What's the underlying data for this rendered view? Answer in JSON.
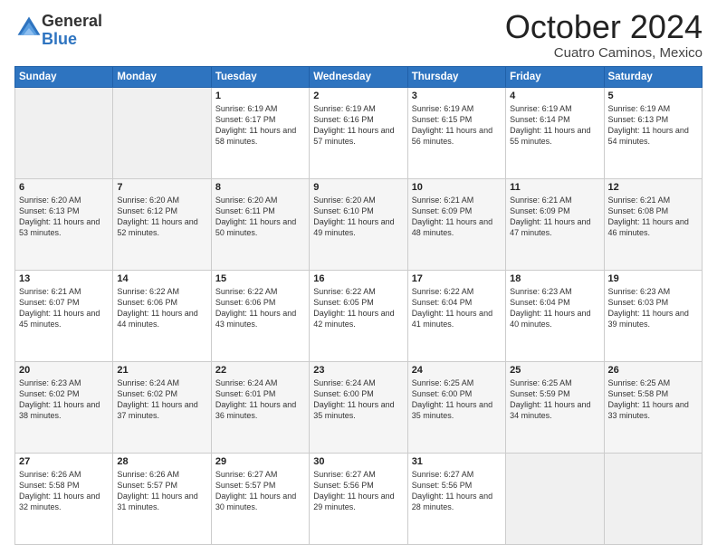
{
  "logo": {
    "general": "General",
    "blue": "Blue"
  },
  "title": {
    "month": "October 2024",
    "location": "Cuatro Caminos, Mexico"
  },
  "headers": [
    "Sunday",
    "Monday",
    "Tuesday",
    "Wednesday",
    "Thursday",
    "Friday",
    "Saturday"
  ],
  "weeks": [
    [
      {
        "day": "",
        "info": ""
      },
      {
        "day": "",
        "info": ""
      },
      {
        "day": "1",
        "info": "Sunrise: 6:19 AM\nSunset: 6:17 PM\nDaylight: 11 hours and 58 minutes."
      },
      {
        "day": "2",
        "info": "Sunrise: 6:19 AM\nSunset: 6:16 PM\nDaylight: 11 hours and 57 minutes."
      },
      {
        "day": "3",
        "info": "Sunrise: 6:19 AM\nSunset: 6:15 PM\nDaylight: 11 hours and 56 minutes."
      },
      {
        "day": "4",
        "info": "Sunrise: 6:19 AM\nSunset: 6:14 PM\nDaylight: 11 hours and 55 minutes."
      },
      {
        "day": "5",
        "info": "Sunrise: 6:19 AM\nSunset: 6:13 PM\nDaylight: 11 hours and 54 minutes."
      }
    ],
    [
      {
        "day": "6",
        "info": "Sunrise: 6:20 AM\nSunset: 6:13 PM\nDaylight: 11 hours and 53 minutes."
      },
      {
        "day": "7",
        "info": "Sunrise: 6:20 AM\nSunset: 6:12 PM\nDaylight: 11 hours and 52 minutes."
      },
      {
        "day": "8",
        "info": "Sunrise: 6:20 AM\nSunset: 6:11 PM\nDaylight: 11 hours and 50 minutes."
      },
      {
        "day": "9",
        "info": "Sunrise: 6:20 AM\nSunset: 6:10 PM\nDaylight: 11 hours and 49 minutes."
      },
      {
        "day": "10",
        "info": "Sunrise: 6:21 AM\nSunset: 6:09 PM\nDaylight: 11 hours and 48 minutes."
      },
      {
        "day": "11",
        "info": "Sunrise: 6:21 AM\nSunset: 6:09 PM\nDaylight: 11 hours and 47 minutes."
      },
      {
        "day": "12",
        "info": "Sunrise: 6:21 AM\nSunset: 6:08 PM\nDaylight: 11 hours and 46 minutes."
      }
    ],
    [
      {
        "day": "13",
        "info": "Sunrise: 6:21 AM\nSunset: 6:07 PM\nDaylight: 11 hours and 45 minutes."
      },
      {
        "day": "14",
        "info": "Sunrise: 6:22 AM\nSunset: 6:06 PM\nDaylight: 11 hours and 44 minutes."
      },
      {
        "day": "15",
        "info": "Sunrise: 6:22 AM\nSunset: 6:06 PM\nDaylight: 11 hours and 43 minutes."
      },
      {
        "day": "16",
        "info": "Sunrise: 6:22 AM\nSunset: 6:05 PM\nDaylight: 11 hours and 42 minutes."
      },
      {
        "day": "17",
        "info": "Sunrise: 6:22 AM\nSunset: 6:04 PM\nDaylight: 11 hours and 41 minutes."
      },
      {
        "day": "18",
        "info": "Sunrise: 6:23 AM\nSunset: 6:04 PM\nDaylight: 11 hours and 40 minutes."
      },
      {
        "day": "19",
        "info": "Sunrise: 6:23 AM\nSunset: 6:03 PM\nDaylight: 11 hours and 39 minutes."
      }
    ],
    [
      {
        "day": "20",
        "info": "Sunrise: 6:23 AM\nSunset: 6:02 PM\nDaylight: 11 hours and 38 minutes."
      },
      {
        "day": "21",
        "info": "Sunrise: 6:24 AM\nSunset: 6:02 PM\nDaylight: 11 hours and 37 minutes."
      },
      {
        "day": "22",
        "info": "Sunrise: 6:24 AM\nSunset: 6:01 PM\nDaylight: 11 hours and 36 minutes."
      },
      {
        "day": "23",
        "info": "Sunrise: 6:24 AM\nSunset: 6:00 PM\nDaylight: 11 hours and 35 minutes."
      },
      {
        "day": "24",
        "info": "Sunrise: 6:25 AM\nSunset: 6:00 PM\nDaylight: 11 hours and 35 minutes."
      },
      {
        "day": "25",
        "info": "Sunrise: 6:25 AM\nSunset: 5:59 PM\nDaylight: 11 hours and 34 minutes."
      },
      {
        "day": "26",
        "info": "Sunrise: 6:25 AM\nSunset: 5:58 PM\nDaylight: 11 hours and 33 minutes."
      }
    ],
    [
      {
        "day": "27",
        "info": "Sunrise: 6:26 AM\nSunset: 5:58 PM\nDaylight: 11 hours and 32 minutes."
      },
      {
        "day": "28",
        "info": "Sunrise: 6:26 AM\nSunset: 5:57 PM\nDaylight: 11 hours and 31 minutes."
      },
      {
        "day": "29",
        "info": "Sunrise: 6:27 AM\nSunset: 5:57 PM\nDaylight: 11 hours and 30 minutes."
      },
      {
        "day": "30",
        "info": "Sunrise: 6:27 AM\nSunset: 5:56 PM\nDaylight: 11 hours and 29 minutes."
      },
      {
        "day": "31",
        "info": "Sunrise: 6:27 AM\nSunset: 5:56 PM\nDaylight: 11 hours and 28 minutes."
      },
      {
        "day": "",
        "info": ""
      },
      {
        "day": "",
        "info": ""
      }
    ]
  ]
}
